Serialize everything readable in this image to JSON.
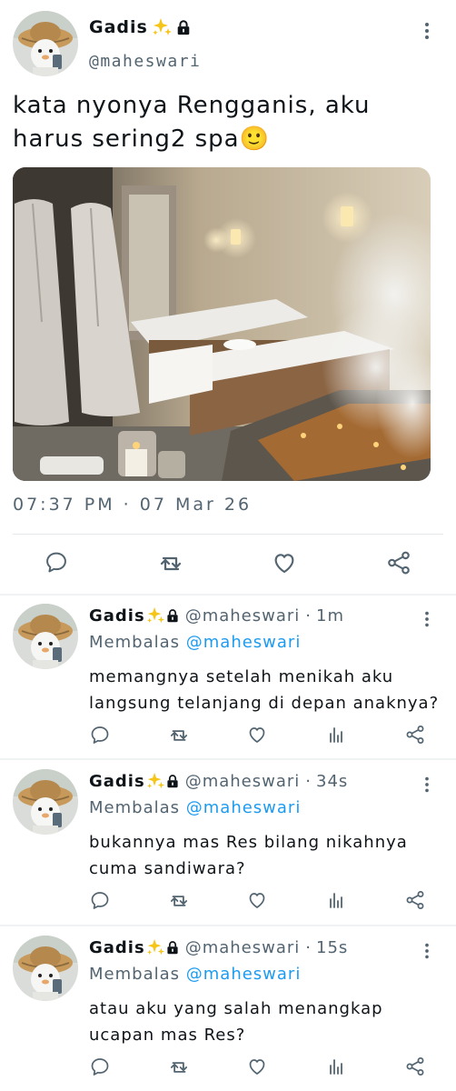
{
  "tweet": {
    "display_name": "Gadis",
    "handle": "@maheswari",
    "text": "kata nyonya Rengganis, aku harus sering2 spa🙂",
    "timestamp": "07:37 PM · 07 Mar 26",
    "image_description": "",
    "actions": [
      "reply-icon",
      "retweet-icon",
      "like-icon",
      "share-icon"
    ]
  },
  "replies": [
    {
      "display_name": "Gadis",
      "handle": "@maheswari",
      "time": "1m",
      "replying_label": "Membalas",
      "replying_to": "@maheswari",
      "text": "memangnya setelah menikah aku langsung telanjang di depan anaknya?"
    },
    {
      "display_name": "Gadis",
      "handle": "@maheswari",
      "time": "34s",
      "replying_label": "Membalas",
      "replying_to": "@maheswari",
      "text": "bukannya mas Res bilang nikahnya cuma sandiwara?"
    },
    {
      "display_name": "Gadis",
      "handle": "@maheswari",
      "time": "15s",
      "replying_label": "Membalas",
      "replying_to": "@maheswari",
      "text": "atau aku yang salah menangkap ucapan mas Res?"
    }
  ],
  "colors": {
    "accent": "#1d9bf0",
    "secondary_text": "#536471",
    "sparkle": "#f5c518"
  }
}
